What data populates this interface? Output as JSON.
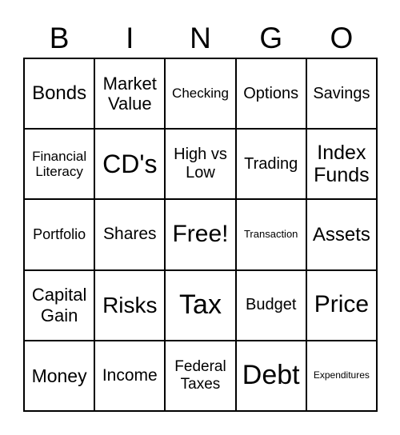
{
  "header": [
    "B",
    "I",
    "N",
    "G",
    "O"
  ],
  "cells": [
    "Bonds",
    "Market Value",
    "Checking",
    "Options",
    "Savings",
    "Financial Literacy",
    "CD's",
    "High vs Low",
    "Trading",
    "Index Funds",
    "Portfolio",
    "Shares",
    "Free!",
    "Transaction",
    "Assets",
    "Capital Gain",
    "Risks",
    "Tax",
    "Budget",
    "Price",
    "Money",
    "Income",
    "Federal Taxes",
    "Debt",
    "Expenditures"
  ]
}
